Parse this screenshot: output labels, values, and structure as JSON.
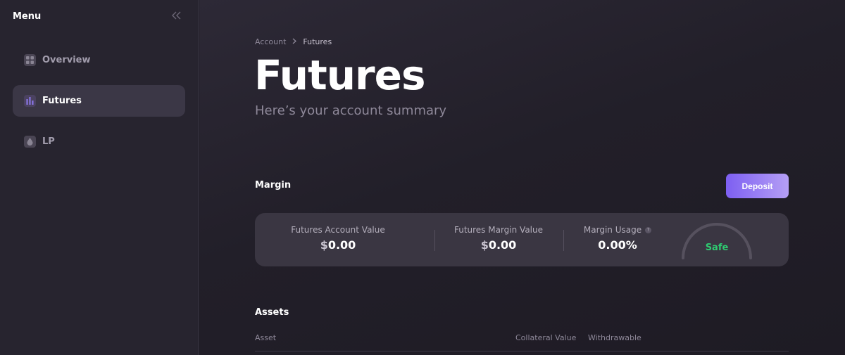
{
  "sidebar": {
    "title": "Menu",
    "collapse_icon": "double-chevron-left-icon",
    "items": [
      {
        "label": "Overview",
        "icon": "grid-icon",
        "active": false
      },
      {
        "label": "Futures",
        "icon": "bar-chart-icon",
        "active": true
      },
      {
        "label": "LP",
        "icon": "droplet-icon",
        "active": false
      }
    ]
  },
  "breadcrumb": {
    "parent": "Account",
    "separator": ">",
    "current": "Futures"
  },
  "page": {
    "title": "Futures",
    "subtitle": "Here’s your account summary"
  },
  "margin": {
    "title": "Margin",
    "deposit_label": "Deposit",
    "stats": [
      {
        "label": "Futures Account Value",
        "currency": "$",
        "value": "0.00"
      },
      {
        "label": "Futures Margin Value",
        "currency": "$",
        "value": "0.00"
      },
      {
        "label": "Margin Usage",
        "value": "0.00%"
      }
    ],
    "gauge_label": "Safe",
    "gauge_level": 0
  },
  "assets": {
    "title": "Assets",
    "columns": [
      "Asset",
      "Collateral Value",
      "Withdrawable"
    ]
  },
  "colors": {
    "accent_start": "#7d5ff2",
    "accent_end": "#b59ff5",
    "safe": "#2ecc71"
  }
}
